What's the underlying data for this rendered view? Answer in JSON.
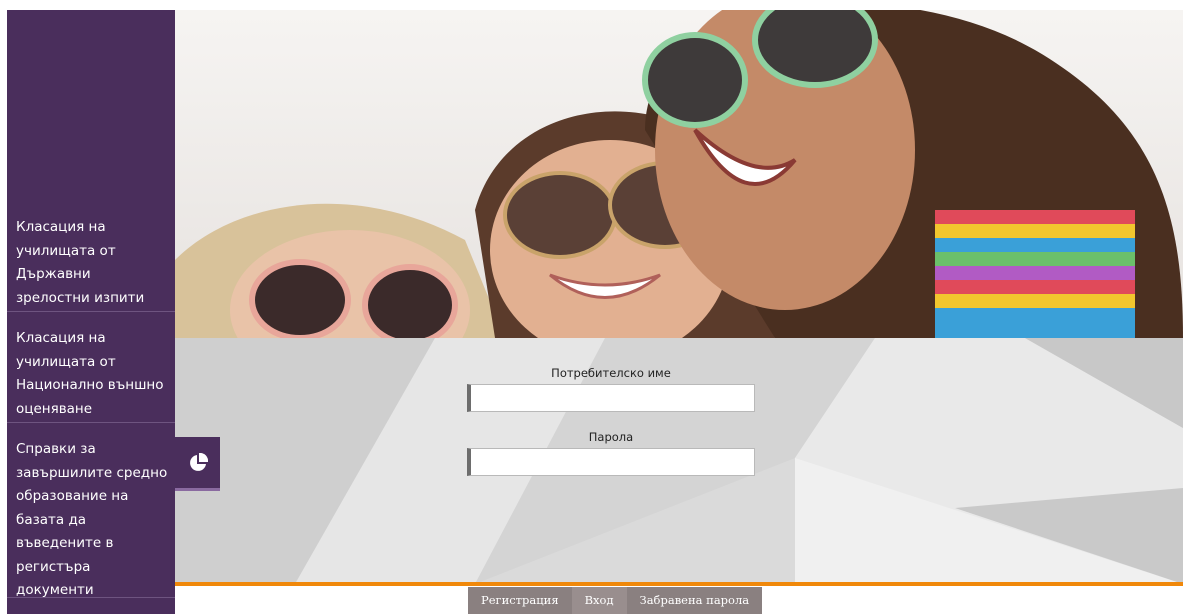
{
  "sidebar": {
    "items": [
      {
        "label": "Класация на\nучилищата от\nДържавни\nзрелостни изпити"
      },
      {
        "label": "Класация на\nучилищата от\nНационално външно\nоценяване"
      },
      {
        "label": "Справки за\nзавършилите средно\nобразование на\nбазата да\nвъведените в\nрегистъра\nдокументи"
      }
    ]
  },
  "hero": {
    "image": "three-laughing-girls-with-sunglasses"
  },
  "login": {
    "username_label": "Потребителско име",
    "username_value": "",
    "password_label": "Парола",
    "password_value": ""
  },
  "float_button": {
    "icon": "pie-chart-icon"
  },
  "tabs": [
    {
      "label": "Регистрация"
    },
    {
      "label": "Вход"
    },
    {
      "label": "Забравена парола"
    }
  ],
  "colors": {
    "sidebar": "#4a2e5c",
    "accent": "#f0880a",
    "tab": "#8a8080"
  }
}
